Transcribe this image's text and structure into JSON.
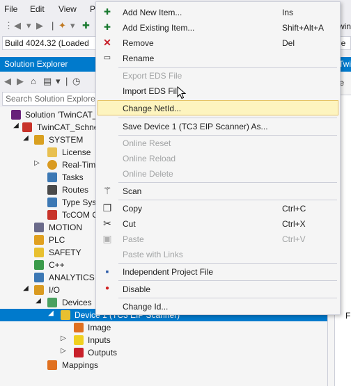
{
  "menubar": {
    "items": [
      "File",
      "Edit",
      "View",
      "Pr"
    ]
  },
  "toolbar": {
    "build_combo": "Build 4024.32 (Loaded",
    "right_combo_a": "win",
    "right_combo_b": "ne"
  },
  "solution_explorer": {
    "title": "Solution Explorer",
    "search_placeholder": "Search Solution Explorer",
    "tree": [
      {
        "label": "Solution 'TwinCAT_S",
        "icon": "solution-icon"
      },
      {
        "label": "TwinCAT_Schnei",
        "icon": "project-icon"
      },
      {
        "label": "SYSTEM",
        "icon": "system-icon"
      },
      {
        "label": "License",
        "icon": "license-icon"
      },
      {
        "label": "Real-Tim",
        "icon": "realtime-icon"
      },
      {
        "label": "Tasks",
        "icon": "tasks-icon"
      },
      {
        "label": "Routes",
        "icon": "routes-icon"
      },
      {
        "label": "Type Syst",
        "icon": "type-system-icon"
      },
      {
        "label": "TcCOM O",
        "icon": "tccom-icon"
      },
      {
        "label": "MOTION",
        "icon": "motion-icon"
      },
      {
        "label": "PLC",
        "icon": "plc-icon"
      },
      {
        "label": "SAFETY",
        "icon": "safety-icon"
      },
      {
        "label": "C++",
        "icon": "cpp-icon"
      },
      {
        "label": "ANALYTICS",
        "icon": "analytics-icon"
      },
      {
        "label": "I/O",
        "icon": "io-icon"
      },
      {
        "label": "Devices",
        "icon": "devices-icon"
      },
      {
        "label": "Device 1 (TC3 EIP Scanner)",
        "icon": "device-icon"
      },
      {
        "label": "Image",
        "icon": "image-icon"
      },
      {
        "label": "Inputs",
        "icon": "inputs-icon"
      },
      {
        "label": "Outputs",
        "icon": "outputs-icon"
      },
      {
        "label": "Mappings",
        "icon": "mappings-icon"
      }
    ]
  },
  "right_panel": {
    "tab": "TwinC",
    "general": "Ge",
    "fr": "Fr"
  },
  "context_menu": {
    "items": [
      {
        "label": "Add New Item...",
        "shortcut": "Ins",
        "icon": "add-new-item-icon",
        "enabled": true
      },
      {
        "label": "Add Existing Item...",
        "shortcut": "Shift+Alt+A",
        "icon": "add-existing-item-icon",
        "enabled": true
      },
      {
        "label": "Remove",
        "shortcut": "Del",
        "icon": "remove-icon",
        "enabled": true
      },
      {
        "label": "Rename",
        "shortcut": "",
        "icon": "rename-icon",
        "enabled": true
      },
      {
        "label": "Export EDS File",
        "shortcut": "",
        "icon": "",
        "enabled": false
      },
      {
        "label": "Import EDS File",
        "shortcut": "",
        "icon": "",
        "enabled": true
      },
      {
        "label": "Change NetId...",
        "shortcut": "",
        "icon": "",
        "enabled": true,
        "hover": true
      },
      {
        "label": "Save Device 1 (TC3 EIP Scanner) As...",
        "shortcut": "",
        "icon": "",
        "enabled": true
      },
      {
        "label": "Online Reset",
        "shortcut": "",
        "icon": "",
        "enabled": false
      },
      {
        "label": "Online Reload",
        "shortcut": "",
        "icon": "",
        "enabled": false
      },
      {
        "label": "Online Delete",
        "shortcut": "",
        "icon": "",
        "enabled": false
      },
      {
        "label": "Scan",
        "shortcut": "",
        "icon": "scan-wand-icon",
        "enabled": true
      },
      {
        "label": "Copy",
        "shortcut": "Ctrl+C",
        "icon": "copy-icon",
        "enabled": true
      },
      {
        "label": "Cut",
        "shortcut": "Ctrl+X",
        "icon": "cut-icon",
        "enabled": true
      },
      {
        "label": "Paste",
        "shortcut": "Ctrl+V",
        "icon": "paste-icon",
        "enabled": false
      },
      {
        "label": "Paste with Links",
        "shortcut": "",
        "icon": "",
        "enabled": false
      },
      {
        "label": "Independent Project File",
        "shortcut": "",
        "icon": "save-disk-icon",
        "enabled": true
      },
      {
        "label": "Disable",
        "shortcut": "",
        "icon": "disable-icon",
        "enabled": true
      },
      {
        "label": "Change Id...",
        "shortcut": "",
        "icon": "",
        "enabled": true
      }
    ]
  },
  "colors": {
    "accent": "#007acc",
    "hover_bg": "#fdf4bf",
    "hover_border": "#e5c365",
    "disabled_text": "#a2a4a5"
  }
}
